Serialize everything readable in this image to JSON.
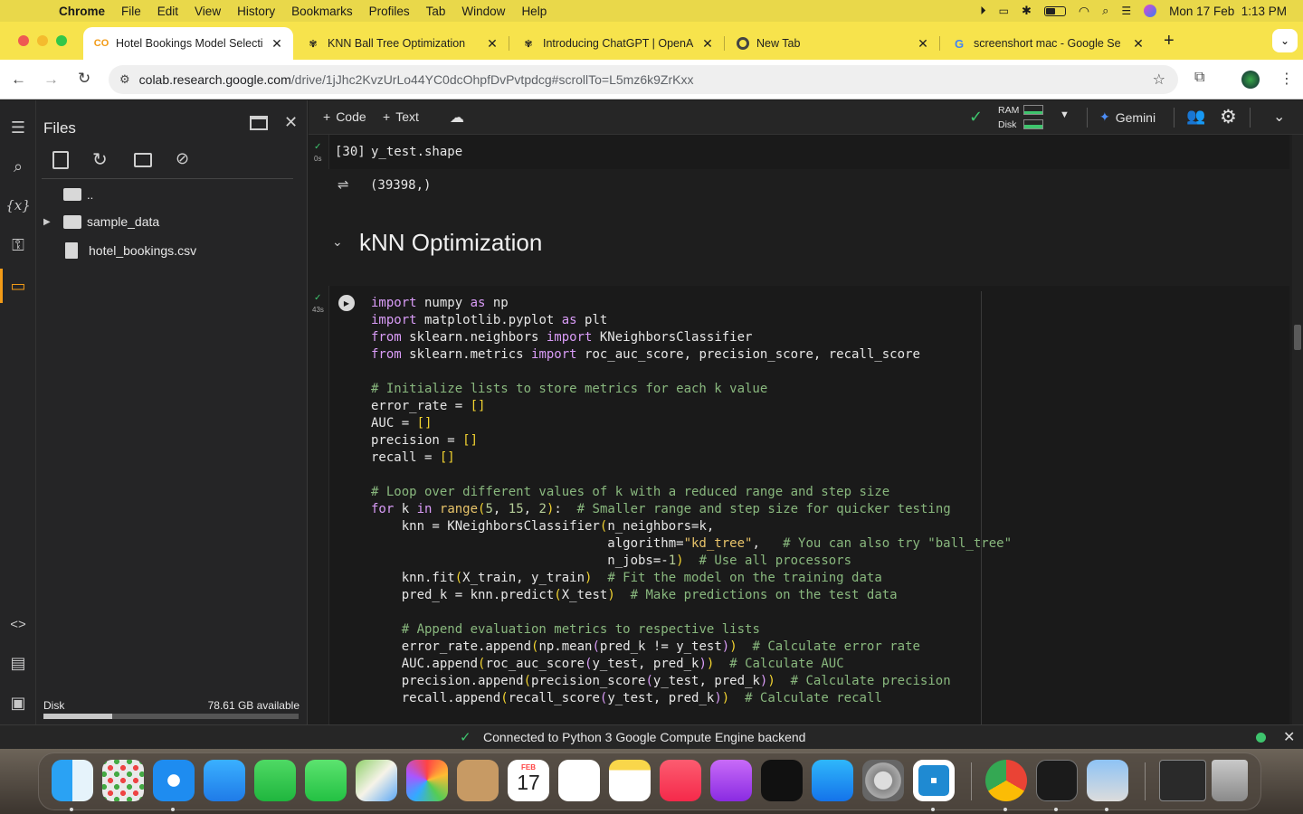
{
  "menubar": {
    "apple": "",
    "app": "Chrome",
    "items": [
      "File",
      "Edit",
      "View",
      "History",
      "Bookmarks",
      "Profiles",
      "Tab",
      "Window",
      "Help"
    ],
    "clock": "Mon 17 Feb  1:13 PM"
  },
  "tabs": [
    {
      "title": "Hotel Bookings Model Selecti",
      "favicon": "CO",
      "active": true
    },
    {
      "title": "KNN Ball Tree Optimization",
      "favicon": "openai-icon",
      "active": false
    },
    {
      "title": "Introducing ChatGPT | OpenA",
      "favicon": "openai-icon",
      "active": false
    },
    {
      "title": "New Tab",
      "favicon": "chrome-icon",
      "active": false
    },
    {
      "title": "screenshort mac - Google Se",
      "favicon": "G",
      "active": false
    }
  ],
  "address": {
    "domain": "colab.research.google.com",
    "path": "/drive/1jJhc2KvzUrLo44YC0dcOhpfDvPvtpdcg#scrollTo=L5mz6k9ZrKxx"
  },
  "files": {
    "title": "Files",
    "parent": "..",
    "items": [
      {
        "name": "sample_data",
        "type": "folder"
      },
      {
        "name": "hotel_bookings.csv",
        "type": "file"
      }
    ],
    "disk_label": "Disk",
    "disk_available": "78.61 GB available",
    "disk_used_fraction": 0.27
  },
  "toolbar": {
    "code": "Code",
    "text": "Text",
    "ram": "RAM",
    "disk": "Disk",
    "gemini": "Gemini"
  },
  "cell30": {
    "exec_time": "0s",
    "prompt": "[30]",
    "source": "y_test.shape",
    "output": "(39398,)"
  },
  "section": {
    "title": "kNN Optimization"
  },
  "cell_knn": {
    "exec_time": "43s"
  },
  "status": {
    "text": "Connected to Python 3 Google Compute Engine backend"
  },
  "dock": {
    "calendar_month": "FEB",
    "calendar_day": "17"
  },
  "colors": {
    "accent_yellow": "#f7e34c",
    "colab_bg": "#1e1e1e",
    "keyword": "#d99cf7",
    "comment": "#89b87e"
  }
}
